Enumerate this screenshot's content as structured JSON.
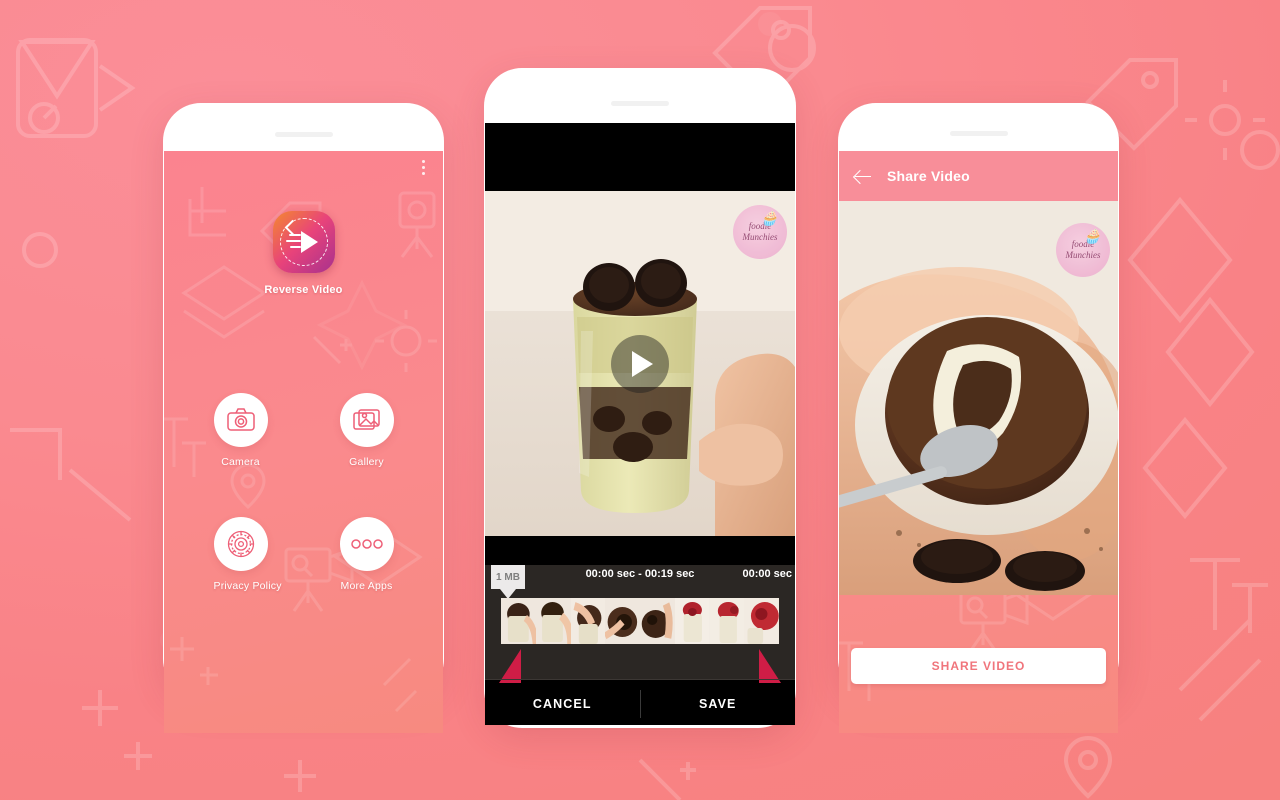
{
  "background": {
    "color_top": "#fb8e98",
    "color_bottom": "#f7817f"
  },
  "phone_home": {
    "overflow_menu": "overflow-menu",
    "app_title": "Reverse Video",
    "tiles": [
      {
        "label": "Camera",
        "icon": "camera-icon"
      },
      {
        "label": "Gallery",
        "icon": "gallery-icon"
      },
      {
        "label": "Privacy Policy",
        "icon": "privacy-shield-icon"
      },
      {
        "label": "More Apps",
        "icon": "more-dots-icon"
      }
    ]
  },
  "phone_editor": {
    "play_icon": "play-icon",
    "watermark": {
      "line1": "foodie",
      "line2": "Munchies",
      "cupcake": "🧁"
    },
    "timeline": {
      "size_badge": "1 MB",
      "range_label": "00:00 sec - 00:19 sec",
      "current_label": "00:00 sec"
    },
    "buttons": {
      "cancel": "CANCEL",
      "save": "SAVE"
    }
  },
  "phone_share": {
    "back_icon": "back-arrow-icon",
    "title": "Share Video",
    "watermark": {
      "line1": "foodie",
      "line2": "Munchies",
      "cupcake": "🧁"
    },
    "share_button": "SHARE VIDEO"
  },
  "colors": {
    "pink": "#fa8a90",
    "handle": "#cf1d46",
    "share_text": "#f0757c"
  }
}
